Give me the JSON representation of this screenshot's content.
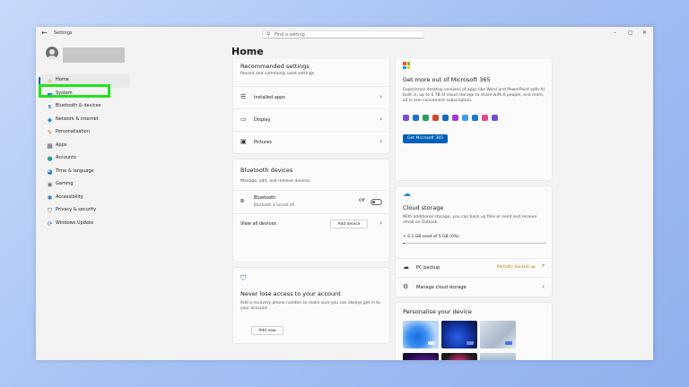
{
  "window": {
    "title": "Settings",
    "search_placeholder": "Find a setting",
    "back_icon": "back-arrow-icon",
    "minimize": "–",
    "maximize": "▢",
    "close": "✕"
  },
  "sidebar": {
    "items": [
      {
        "label": "Home",
        "icon": "home-icon",
        "glyph": "⌂",
        "color": "#e8a23a",
        "active": true
      },
      {
        "label": "System",
        "icon": "monitor-icon",
        "glyph": "▬",
        "color": "#2b7cd3"
      },
      {
        "label": "Bluetooth & devices",
        "icon": "bluetooth-icon",
        "glyph": "ʙ",
        "color": "#1f6fd1"
      },
      {
        "label": "Network & internet",
        "icon": "wifi-icon",
        "glyph": "◆",
        "color": "#2a8bd8"
      },
      {
        "label": "Personalisation",
        "icon": "brush-icon",
        "glyph": "✎",
        "color": "#d9822b"
      },
      {
        "label": "Apps",
        "icon": "apps-icon",
        "glyph": "▦",
        "color": "#555a66"
      },
      {
        "label": "Accounts",
        "icon": "person-icon",
        "glyph": "●",
        "color": "#2aa38c"
      },
      {
        "label": "Time & language",
        "icon": "globe-icon",
        "glyph": "◕",
        "color": "#2b7cd3"
      },
      {
        "label": "Gaming",
        "icon": "gamepad-icon",
        "glyph": "◉",
        "color": "#777"
      },
      {
        "label": "Accessibility",
        "icon": "accessibility-icon",
        "glyph": "✱",
        "color": "#2b6fd3"
      },
      {
        "label": "Privacy & security",
        "icon": "shield-icon",
        "glyph": "⛉",
        "color": "#777"
      },
      {
        "label": "Windows Update",
        "icon": "update-icon",
        "glyph": "⟳",
        "color": "#1f78d1"
      }
    ]
  },
  "page": {
    "title": "Home"
  },
  "recommended": {
    "title": "Recommended settings",
    "subtitle": "Recent and commonly used settings",
    "rows": [
      {
        "label": "Installed apps",
        "icon": "list-icon",
        "glyph": "☰"
      },
      {
        "label": "Display",
        "icon": "display-icon",
        "glyph": "▭"
      },
      {
        "label": "Pictures",
        "icon": "picture-icon",
        "glyph": "▣"
      }
    ],
    "chevron": "›"
  },
  "bluetooth": {
    "title": "Bluetooth devices",
    "subtitle": "Manage, add, and remove devices",
    "item_label": "Bluetooth",
    "item_status": "Bluetooth is turned off",
    "toggle_state": "Off",
    "view_all": "View all devices",
    "add_device": "Add device"
  },
  "account": {
    "title": "Never lose access to your account",
    "description": "Add a recovery phone number to make sure you can always get in to your account.",
    "button": "Add now"
  },
  "m365": {
    "title": "Get more out of Microsoft 365",
    "description": "Experience desktop versions of apps like Word and PowerPoint with AI built in, up to 6 TB of cloud storage to share with 6 people, and more, all in one convenient subscription.",
    "button": "Get Microsoft 365",
    "app_colors": [
      "#7b4fd6",
      "#1e6fd1",
      "#2a9d5a",
      "#d24726",
      "#0f6cbd",
      "#a33ad1",
      "#3aa0e8",
      "#1f78d1",
      "#e2478a",
      "#6a4dd8"
    ]
  },
  "cloud": {
    "title": "Cloud storage",
    "description": "With additional storage, you can back up files or send and receive email on Outlook.",
    "usage": "< 0.1 GB used of 5 GB (0%)",
    "usage_fraction": 0.01,
    "backup_label": "PC backup",
    "backup_status": "Partially backed up",
    "manage_label": "Manage cloud storage"
  },
  "personalise": {
    "title": "Personalise your device"
  }
}
